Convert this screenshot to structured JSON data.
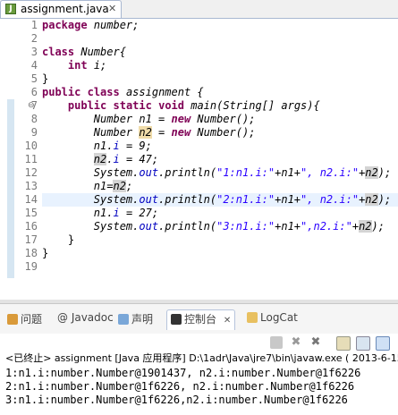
{
  "editor_tab": {
    "label": "assignment.java",
    "close": "✕"
  },
  "line_numbers": [
    "1",
    "2",
    "3",
    "4",
    "5",
    "6",
    "7",
    "8",
    "9",
    "10",
    "11",
    "12",
    "13",
    "14",
    "15",
    "16",
    "17",
    "18",
    "19"
  ],
  "code": {
    "l1_kw": "package",
    "l1_rest": " number;",
    "l3_kw": "class",
    "l3_rest": " Number{",
    "l4_kw": "int",
    "l4_rest": " i;",
    "l5": "}",
    "l6_kw1": "public",
    "l6_kw2": "class",
    "l6_rest": " assignment {",
    "l7_kw1": "public",
    "l7_kw2": "static",
    "l7_kw3": "void",
    "l7_rest": " main(String[] args){",
    "l8_a": "Number n1 = ",
    "l8_kw": "new",
    "l8_b": " Number();",
    "l9_a": "Number ",
    "l9_hl": "n2",
    "l9_b": " = ",
    "l9_kw": "new",
    "l9_c": " Number();",
    "l10_a": "n1.",
    "l10_f": "i",
    "l10_b": " = 9;",
    "l11_hl": "n2",
    "l11_a": ".",
    "l11_f": "i",
    "l11_b": " = 47;",
    "l12_a": "System.",
    "l12_out": "out",
    "l12_b": ".println(",
    "l12_s1": "\"1:n1.i:\"",
    "l12_c": "+n1+",
    "l12_s2": "\", n2.i:\"",
    "l12_d": "+",
    "l12_hl": "n2",
    "l12_e": ");",
    "l13_a": "n1=",
    "l13_hl": "n2",
    "l13_b": ";",
    "l14_a": "System.",
    "l14_out": "out",
    "l14_b": ".println(",
    "l14_s1": "\"2:n1.i:\"",
    "l14_c": "+n1+",
    "l14_s2": "\", n2.i:\"",
    "l14_d": "+",
    "l14_hl": "n2",
    "l14_e": ");",
    "l15_a": "n1.",
    "l15_f": "i",
    "l15_b": " = 27;",
    "l16_a": "System.",
    "l16_out": "out",
    "l16_b": ".println(",
    "l16_s1": "\"3:n1.i:\"",
    "l16_c": "+n1+",
    "l16_s2": "\",n2.i:\"",
    "l16_d": "+",
    "l16_hl": "n2",
    "l16_e": ");",
    "l17": "}",
    "l18": "}"
  },
  "view_tabs": [
    "问题",
    "@ Javadoc",
    "声明",
    "控制台",
    "LogCat"
  ],
  "console_title": "<已终止> assignment [Java 应用程序] D:\\1adr\\Java\\jre7\\bin\\javaw.exe ( 2013-6-15",
  "console_lines": [
    "1:n1.i:number.Number@1901437, n2.i:number.Number@1f6226",
    "2:n1.i:number.Number@1f6226, n2.i:number.Number@1f6226",
    "3:n1.i:number.Number@1f6226,n2.i:number.Number@1f6226"
  ],
  "colors": {
    "keyword": "#7f0055",
    "field": "#0000c0",
    "string": "#2a00ff",
    "current_line": "#e8f2fe"
  }
}
